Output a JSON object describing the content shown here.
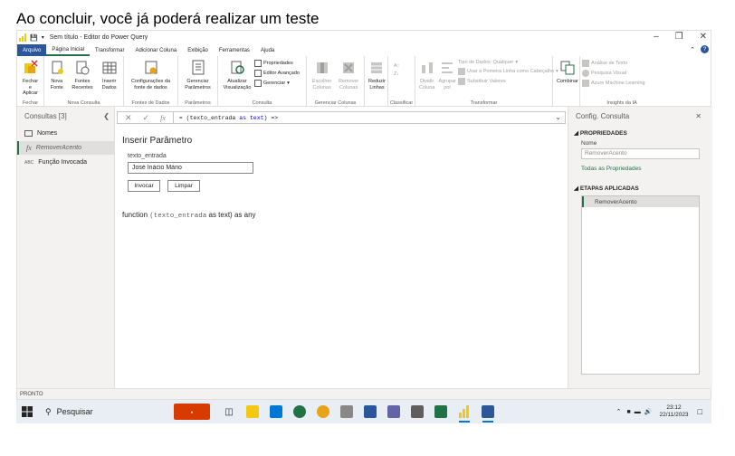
{
  "caption": "Ao concluir, você já poderá realizar um teste",
  "window": {
    "title": "Sem título - Editor do Power Query"
  },
  "tabs": [
    "Arquivo",
    "Página Inicial",
    "Transformar",
    "Adicionar Coluna",
    "Exibição",
    "Ferramentas",
    "Ajuda"
  ],
  "ribbon": {
    "close_apply": "Fechar e Aplicar",
    "new_source": "Nova Fonte",
    "recent_sources": "Fontes Recentes",
    "enter_data": "Inserir Dados",
    "datasource_settings": "Configurações da fonte de dados",
    "manage_params": "Gerenciar Parâmetros",
    "refresh_preview": "Atualizar Visualização",
    "properties": "Propriedades",
    "adv_editor": "Editor Avançado",
    "manage": "Gerenciar",
    "choose_cols": "Escolher Colunas",
    "remove_cols": "Remover Colunas",
    "reduce_rows": "Reduzir Linhas",
    "split_col": "Dividir Coluna",
    "group_by": "Agrupar por",
    "data_type": "Tipo de Dados: Qualquer",
    "first_row_header": "Usar a Primeira Linha como Cabeçalho",
    "replace_values": "Substituir Valores",
    "combine": "Combinar",
    "text_analytics": "Análise de Texto",
    "vision": "Pesquisa Visual",
    "azure_ml": "Azure Machine Learning",
    "groups": {
      "close": "Fechar",
      "new_query": "Nova Consulta",
      "data_sources": "Fontes de Dados",
      "parameters": "Parâmetros",
      "query": "Consulta",
      "manage_columns": "Gerenciar Colunas",
      "sort": "Classificar",
      "transform": "Transformar",
      "ai_insights": "Insights da IA"
    }
  },
  "left_pane": {
    "title": "Consultas [3]",
    "items": [
      {
        "label": "Nomes"
      },
      {
        "label": "RemoverAcento"
      },
      {
        "label": "Função Invocada"
      }
    ]
  },
  "formula_bar": {
    "prefix": "= (texto_entrada ",
    "keyword_as": "as",
    "type": " text",
    "suffix": ") =>"
  },
  "invoke_panel": {
    "title": "Inserir Parâmetro",
    "param_label": "texto_entrada",
    "param_value": "José Inácio Mário",
    "invoke_button": "Invocar",
    "clear_button": "Limpar",
    "signature_prefix": "function ",
    "signature_mono": "(texto_entrada",
    "signature_suffix": " as text) as any"
  },
  "right_pane": {
    "title": "Config. Consulta",
    "properties_header": "PROPRIEDADES",
    "name_label": "Nome",
    "name_value": "RemoverAcento",
    "all_properties_link": "Todas as Propriedades",
    "applied_steps_header": "ETAPAS APLICADAS",
    "steps": [
      "RemoverAcento"
    ]
  },
  "status_bar": "PRONTO",
  "taskbar": {
    "search_label": "Pesquisar",
    "time": "23:12",
    "date": "22/11/2023"
  }
}
